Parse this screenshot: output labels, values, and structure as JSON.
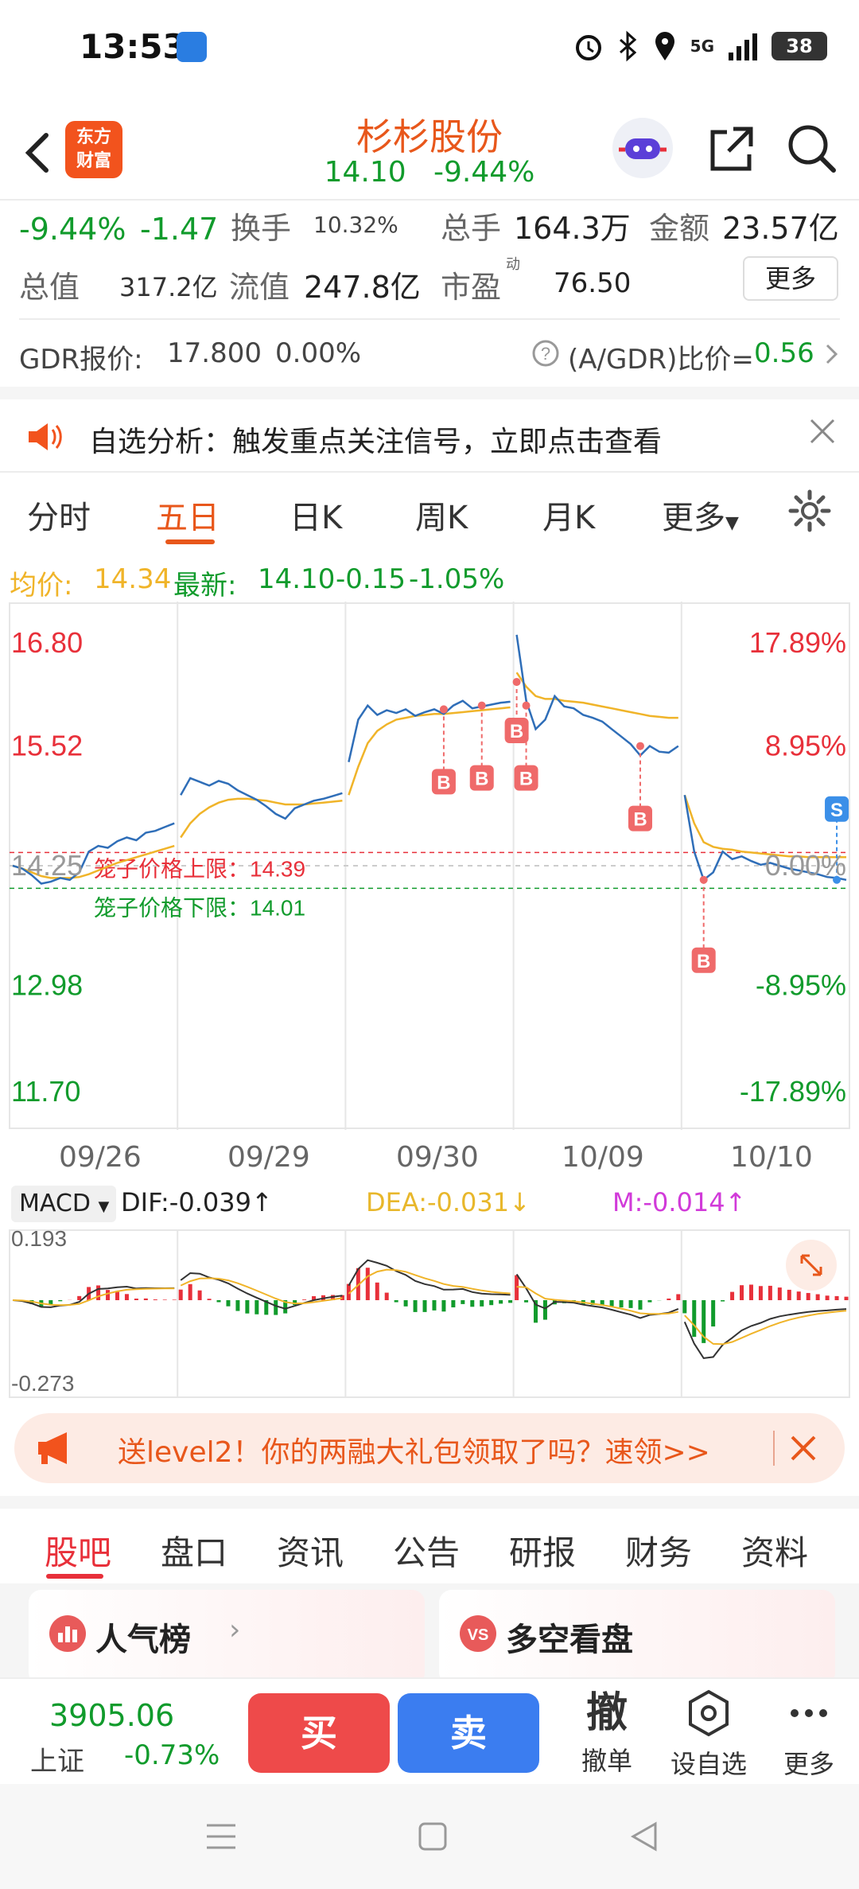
{
  "status_bar": {
    "time": "13:53",
    "signal_label": "5G",
    "battery": "38"
  },
  "header": {
    "logo_line1": "东方",
    "logo_line2": "财富",
    "stock_name": "杉杉股份",
    "price": "14.10",
    "change_pct": "-9.44%"
  },
  "quote": {
    "change_pct": "-9.44%",
    "change_amt": "-1.47",
    "turnover_label": "换手",
    "turnover_value": "10.32%",
    "total_hands_label": "总手",
    "total_hands_value": "164.3万",
    "amount_label": "金额",
    "amount_value": "23.57亿",
    "total_value_label": "总值",
    "total_value_value": "317.2亿",
    "float_value_label": "流值",
    "float_value_value": "247.8亿",
    "pe_label": "市盈",
    "pe_superscript": "动",
    "pe_value": "76.50",
    "more_label": "更多"
  },
  "gdr": {
    "label": "GDR报价:",
    "price": "17.800",
    "change": "0.00%",
    "ratio_label": "(A/GDR)比价=",
    "ratio_value": "0.56"
  },
  "notice": {
    "text": "自选分析：触发重点关注信号，立即点击查看"
  },
  "chart_tabs": [
    {
      "label": "分时"
    },
    {
      "label": "五日"
    },
    {
      "label": "日K"
    },
    {
      "label": "周K"
    },
    {
      "label": "月K"
    },
    {
      "label": "更多"
    }
  ],
  "avg_line": {
    "avg_label": "均价:",
    "avg_value": "14.34",
    "latest_label": "最新:",
    "latest_value": "14.10",
    "latest_chg": "-0.15",
    "latest_pct": "-1.05%"
  },
  "chart_data": {
    "type": "line",
    "x": [
      "09/26",
      "09/29",
      "09/30",
      "10/09",
      "10/10"
    ],
    "y_ticks_left": [
      "16.80",
      "15.52",
      "14.25",
      "12.98",
      "11.70"
    ],
    "y_ticks_right": [
      "17.89%",
      "8.95%",
      "0.00%",
      "-8.95%",
      "-17.89%"
    ],
    "ylim": [
      11.7,
      16.8
    ],
    "cage_upper_label": "笼子价格上限：14.39",
    "cage_lower_label": "笼子价格下限：14.01",
    "price_series": [
      14.25,
      14.22,
      14.15,
      14.06,
      14.08,
      14.12,
      14.1,
      14.18,
      14.4,
      14.46,
      14.44,
      14.51,
      14.55,
      14.52,
      14.6,
      14.62,
      14.66,
      14.7,
      15.0,
      15.18,
      15.14,
      15.1,
      15.15,
      15.12,
      15.05,
      15.0,
      14.95,
      14.88,
      14.8,
      14.75,
      14.86,
      14.9,
      14.94,
      14.96,
      14.99,
      15.02,
      15.35,
      15.8,
      15.95,
      15.85,
      15.9,
      15.87,
      15.91,
      15.84,
      15.88,
      15.91,
      15.86,
      15.95,
      16.0,
      15.92,
      15.94,
      15.96,
      15.98,
      15.99,
      16.7,
      16.0,
      15.7,
      15.8,
      16.05,
      15.94,
      15.92,
      15.85,
      15.82,
      15.78,
      15.7,
      15.62,
      15.54,
      15.42,
      15.52,
      15.46,
      15.45,
      15.52,
      15.0,
      14.4,
      14.1,
      14.18,
      14.4,
      14.32,
      14.35,
      14.3,
      14.26,
      14.28,
      14.25,
      14.22,
      14.2,
      14.18,
      14.16,
      14.13,
      14.12,
      14.1
    ],
    "avg_series": [
      14.25,
      14.22,
      14.18,
      14.14,
      14.12,
      14.12,
      14.12,
      14.13,
      14.16,
      14.2,
      14.24,
      14.28,
      14.31,
      14.34,
      14.37,
      14.4,
      14.43,
      14.46,
      14.55,
      14.7,
      14.8,
      14.87,
      14.92,
      14.95,
      14.96,
      14.96,
      14.95,
      14.94,
      14.92,
      14.9,
      14.9,
      14.9,
      14.91,
      14.92,
      14.93,
      14.94,
      15.0,
      15.3,
      15.55,
      15.68,
      15.75,
      15.8,
      15.82,
      15.84,
      15.85,
      15.86,
      15.86,
      15.87,
      15.88,
      15.89,
      15.9,
      15.91,
      15.92,
      15.93,
      16.3,
      16.15,
      16.05,
      16.02,
      16.02,
      16.0,
      15.99,
      15.98,
      15.96,
      15.94,
      15.92,
      15.9,
      15.88,
      15.86,
      15.84,
      15.83,
      15.82,
      15.82,
      15.0,
      14.7,
      14.5,
      14.45,
      14.43,
      14.42,
      14.4,
      14.39,
      14.38,
      14.37,
      14.36,
      14.35,
      14.35,
      14.34,
      14.34,
      14.34,
      14.34,
      14.34
    ],
    "trade_marks": [
      {
        "type": "B",
        "day": 2,
        "index": 10,
        "price": 15.91
      },
      {
        "type": "B",
        "day": 2,
        "index": 14,
        "price": 15.95
      },
      {
        "type": "B",
        "day": 3,
        "index": 0,
        "price": 16.2
      },
      {
        "type": "B",
        "day": 3,
        "index": 1,
        "price": 15.95
      },
      {
        "type": "B",
        "day": 3,
        "index": 13,
        "price": 15.52
      },
      {
        "type": "B",
        "day": 4,
        "index": 2,
        "price": 14.1
      },
      {
        "type": "S",
        "day": 4,
        "index": 16,
        "price": 14.1
      }
    ]
  },
  "macd": {
    "select_label": "MACD",
    "dif": "DIF:-0.039",
    "dea": "DEA:-0.031",
    "m": "M:-0.014",
    "y_top": "0.193",
    "y_bottom": "-0.273"
  },
  "promo": {
    "text": "送level2！你的两融大礼包领取了吗？速领>>"
  },
  "section_tabs": [
    {
      "label": "股吧"
    },
    {
      "label": "盘口"
    },
    {
      "label": "资讯"
    },
    {
      "label": "公告"
    },
    {
      "label": "研报"
    },
    {
      "label": "财务"
    },
    {
      "label": "资料"
    }
  ],
  "cards": [
    {
      "title": "人气榜"
    },
    {
      "title": "多空看盘"
    }
  ],
  "trade_bar": {
    "index_value": "3905.06",
    "index_name": "上证",
    "index_change": "-0.73%",
    "buy_label": "买",
    "sell_label": "卖",
    "cancel_char": "撤",
    "cancel_label": "撤单",
    "watch_label": "设自选",
    "more_label": "更多"
  },
  "colors": {
    "up": "#e8303a",
    "down": "#119b2c",
    "accent": "#e8571b",
    "price_line": "#2f6eb8",
    "avg_line": "#f0b429"
  }
}
